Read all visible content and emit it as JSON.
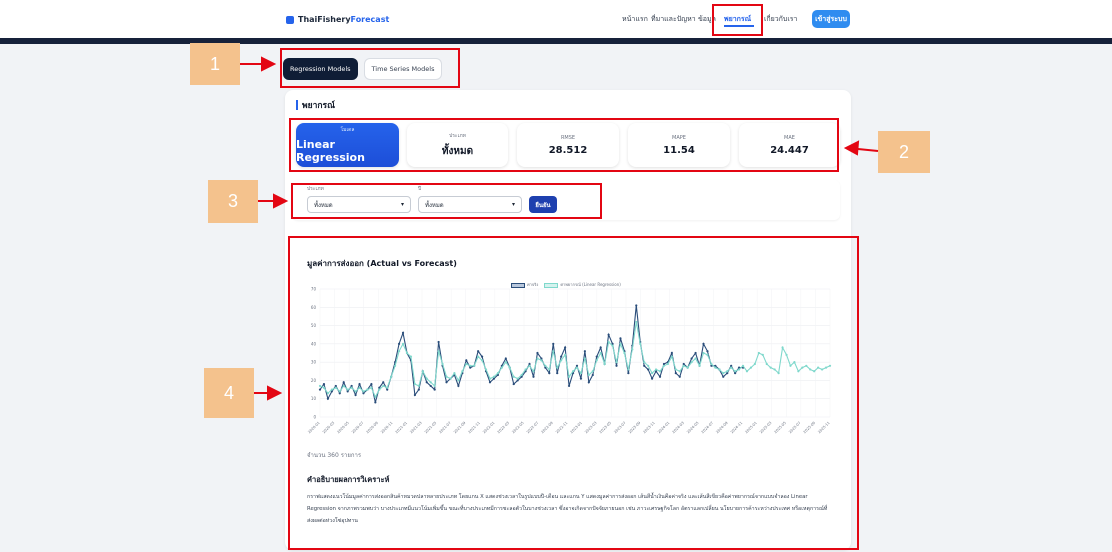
{
  "header": {
    "brand_main": "ThaiFishery",
    "brand_accent": "Forecast",
    "nav": [
      "หน้าแรก",
      "ที่มาและปัญหา",
      "ข้อมูล",
      "พยากรณ์",
      "เกี่ยวกับเรา"
    ],
    "login": "เข้าสู่ระบบ"
  },
  "tabs": [
    "Regression Models",
    "Time Series Models"
  ],
  "section_title": "พยากรณ์",
  "metrics": [
    {
      "label": "โมเดล",
      "value": "Linear Regression"
    },
    {
      "label": "ประเภท",
      "value": "ทั้งหมด"
    },
    {
      "label": "RMSE",
      "value": "28.512"
    },
    {
      "label": "MAPE",
      "value": "11.54"
    },
    {
      "label": "MAE",
      "value": "24.447"
    }
  ],
  "filters": {
    "type_label": "ประเภท",
    "type_value": "ทั้งหมด",
    "year_label": "ปี",
    "year_value": "ทั้งหมด",
    "apply": "ยืนยัน"
  },
  "chart": {
    "title": "มูลค่าการส่งออก (Actual vs Forecast)",
    "legend_actual": "ค่าจริง",
    "legend_forecast": "ค่าพยากรณ์ (Linear Regression)",
    "count": "จำนวน 360 รายการ"
  },
  "analysis": {
    "title": "คำอธิบายผลการวิเคราะห์",
    "text": "กราฟแสดงแนวโน้มมูลค่าการส่งออกสินค้าหมวดปลาหลายประเภท โดยแกน X แสดงช่วงเวลาในรูปแบบปี-เดือน และแกน Y แสดงมูลค่าการส่งออก เส้นสีน้ำเงินคือค่าจริง และเส้นสีเขียวคือค่าพยากรณ์จากแบบจำลอง Linear Regression จากภาพรวมพบว่า บางประเภทมีแนวโน้มเพิ่มขึ้น ขณะที่บางประเภทมีการชะลอตัวในบางช่วงเวลา ซึ่งอาจเกิดจากปัจจัยภายนอก เช่น ภาวะเศรษฐกิจโลก อัตราแลกเปลี่ยน นโยบายการค้าระหว่างประเทศ หรือเหตุการณ์ที่ส่งผลต่อห่วงโซ่อุปทาน"
  },
  "annotations": [
    "1",
    "2",
    "3",
    "4"
  ],
  "colors": {
    "accent": "#2563eb",
    "nav_dark": "#16213a",
    "actual_line": "#2a4d7a",
    "forecast_line": "#7fd8cc",
    "annotation_red": "#e30613",
    "annotation_box": "#f4c28d"
  },
  "chart_data": {
    "type": "line",
    "title": "มูลค่าการส่งออก (Actual vs Forecast)",
    "xlabel": "",
    "ylabel": "",
    "ylim": [
      0,
      70
    ],
    "yticks": [
      0,
      10,
      20,
      30,
      40,
      50,
      60,
      70
    ],
    "categories": [
      "2020-01",
      "2020-03",
      "2020-05",
      "2020-07",
      "2020-09",
      "2020-11",
      "2021-01",
      "2021-03",
      "2021-05",
      "2021-07",
      "2021-09",
      "2021-11",
      "2022-01",
      "2022-03",
      "2022-05",
      "2022-07",
      "2022-09",
      "2022-11",
      "2023-01",
      "2023-03",
      "2023-05",
      "2023-07",
      "2023-09",
      "2023-11",
      "2024-01",
      "2024-03",
      "2024-05",
      "2024-07",
      "2024-09",
      "2024-11",
      "2025-01",
      "2025-03",
      "2025-05",
      "2025-07",
      "2025-09",
      "2025-11"
    ],
    "series": [
      {
        "name": "ค่าจริง",
        "values": [
          15,
          18,
          10,
          14,
          17,
          13,
          19,
          14,
          17,
          12,
          18,
          13,
          15,
          18,
          8,
          16,
          19,
          15,
          22,
          30,
          40,
          46,
          35,
          31,
          12,
          15,
          25,
          19,
          17,
          15,
          41,
          28,
          19,
          21,
          23,
          17,
          24,
          31,
          27,
          28,
          36,
          33,
          25,
          19,
          21,
          23,
          28,
          32,
          27,
          18,
          20,
          22,
          25,
          29,
          22,
          35,
          32,
          27,
          24,
          40,
          24,
          33,
          38,
          17,
          24,
          28,
          21,
          36,
          19,
          23,
          33,
          38,
          29,
          45,
          40,
          28,
          43,
          36,
          24,
          39,
          61,
          41,
          28,
          26,
          21,
          25,
          22,
          29,
          30,
          35,
          24,
          22,
          29,
          27,
          32,
          35,
          28,
          40,
          36,
          28,
          28,
          26,
          22,
          24,
          28,
          24,
          27,
          27
        ]
      },
      {
        "name": "ค่าพยากรณ์ (Linear Regression)",
        "values": [
          17,
          16,
          13,
          15,
          16,
          14,
          17,
          15,
          16,
          14,
          16,
          14,
          15,
          16,
          11,
          15,
          17,
          16,
          22,
          28,
          36,
          40,
          35,
          33,
          18,
          17,
          25,
          21,
          19,
          17,
          36,
          29,
          22,
          21,
          24,
          20,
          25,
          29,
          28,
          28,
          33,
          31,
          26,
          21,
          22,
          24,
          27,
          30,
          27,
          22,
          21,
          23,
          26,
          28,
          25,
          32,
          31,
          28,
          26,
          36,
          27,
          31,
          34,
          22,
          25,
          27,
          24,
          32,
          23,
          25,
          31,
          35,
          29,
          41,
          39,
          30,
          40,
          35,
          26,
          37,
          52,
          40,
          30,
          28,
          24,
          26,
          25,
          28,
          29,
          33,
          26,
          25,
          28,
          27,
          30,
          32,
          28,
          35,
          34,
          29,
          27,
          26,
          24,
          25,
          27,
          25,
          26,
          28,
          25,
          27,
          29,
          35,
          34,
          29,
          27,
          26,
          24,
          38,
          34,
          28,
          30,
          25,
          27,
          28,
          26,
          25,
          27,
          26,
          27,
          28
        ]
      }
    ],
    "grid": true,
    "legend": "top-center"
  }
}
